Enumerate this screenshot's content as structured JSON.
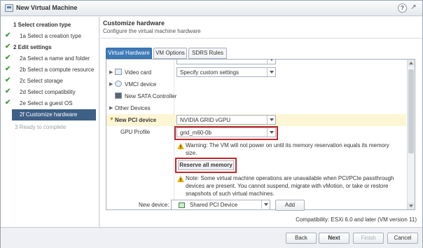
{
  "window": {
    "title": "New Virtual Machine"
  },
  "sidebar": {
    "steps": [
      {
        "label": "1  Select creation type",
        "state": "header"
      },
      {
        "label": "1a  Select a creation type",
        "state": "done"
      },
      {
        "label": "2  Edit settings",
        "state": "header"
      },
      {
        "label": "2a  Select a name and folder",
        "state": "done"
      },
      {
        "label": "2b  Select a compute resource",
        "state": "done"
      },
      {
        "label": "2c  Select storage",
        "state": "done"
      },
      {
        "label": "2d  Select compatibility",
        "state": "done"
      },
      {
        "label": "2e  Select a guest OS",
        "state": "done"
      },
      {
        "label": "2f  Customize hardware",
        "state": "active"
      },
      {
        "label": "3  Ready to complete",
        "state": "disabled"
      }
    ]
  },
  "main": {
    "heading": "Customize hardware",
    "subheading": "Configure the virtual machine hardware",
    "tabs": [
      "Virtual Hardware",
      "VM Options",
      "SDRS Rules"
    ]
  },
  "hardware": {
    "video_card": {
      "label": "Video card",
      "value": "Specify custom settings"
    },
    "vmci": {
      "label": "VMCI device"
    },
    "sata": {
      "label": "New SATA Controller"
    },
    "other": {
      "label": "Other Devices"
    },
    "pci": {
      "label": "New PCI device",
      "value": "NVIDIA GRID vGPU"
    },
    "gpu_profile": {
      "label": "GPU Profile",
      "value": "grid_m60-0b"
    },
    "warning": "Warning: The VM will not power on until its memory reservation equals its memory size.",
    "reserve_button": "Reserve all memory",
    "note": "Note: Some virtual machine operations are unavailable when PCI/PCIe passthrough devices are present. You cannot suspend, migrate with vMotion, or take or restore snapshots of such virtual machines."
  },
  "new_device": {
    "label": "New device:",
    "value": "Shared PCI Device",
    "add_label": "Add"
  },
  "compatibility": "Compatibility: ESXi 6.0 and later (VM version 11)",
  "footer": {
    "back": "Back",
    "next": "Next",
    "finish": "Finish",
    "cancel": "Cancel"
  },
  "colors": {
    "accent": "#3e7ab8",
    "active_step": "#3e5f86",
    "highlight_row": "#fdf6d5",
    "callout_border": "#c0282c",
    "check": "#3c9d3c",
    "warning": "#f0b400"
  },
  "icons": [
    "vm-icon",
    "help-icon",
    "maximize-icon",
    "check-icon",
    "video-card-icon",
    "vmci-icon",
    "sata-icon",
    "warning-icon",
    "shared-pci-icon",
    "chevron-down-icon"
  ]
}
